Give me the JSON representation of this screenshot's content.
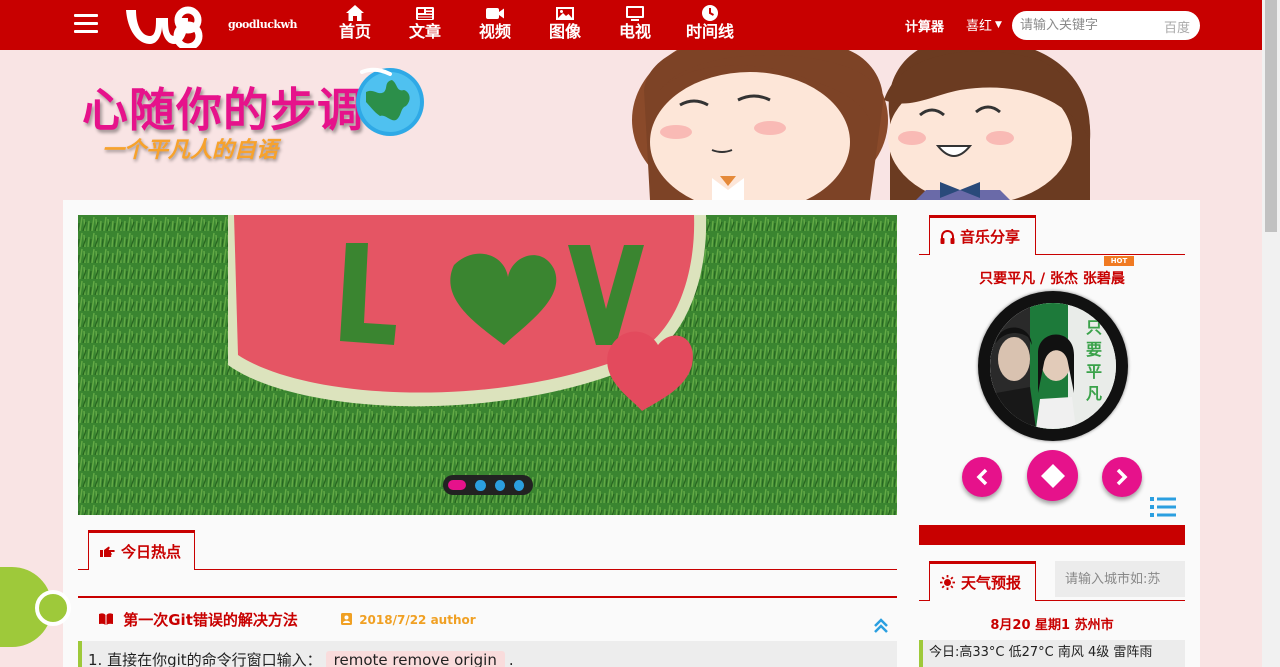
{
  "header": {
    "menu_icon": "hamburger-icon",
    "logo_icon": "w8-logo-icon",
    "site_name": "goodluckwh",
    "nav": [
      {
        "label": "首页",
        "icon": "home-icon"
      },
      {
        "label": "文章",
        "icon": "newspaper-icon"
      },
      {
        "label": "视频",
        "icon": "video-camera-icon"
      },
      {
        "label": "图像",
        "icon": "image-icon"
      },
      {
        "label": "电视",
        "icon": "tv-icon"
      },
      {
        "label": "时间线",
        "icon": "clock-icon"
      }
    ],
    "calculator": "计算器",
    "user": "喜红",
    "search": {
      "placeholder": "请输入关键字",
      "engine": "百度"
    }
  },
  "banner": {
    "title": "心随你的步调",
    "subtitle": "一个平凡人的自语"
  },
  "slider": {
    "image_icon": "watermelon-love-photo",
    "slide_count": 4,
    "active_slide": 1
  },
  "hot": {
    "tab_label": "今日热点",
    "tab_icon": "hand-pointing-icon"
  },
  "article": {
    "title": "第一次Git错误的解决方法",
    "title_icon": "books-icon",
    "meta": "2018/7/22 author",
    "meta_icon": "user-badge-icon",
    "body_prefix": "1. 直接在你git的命令行窗口输入：",
    "body_code": "remote remove origin",
    "body_suffix": "."
  },
  "music": {
    "tab_label": "音乐分享",
    "tab_icon": "headphones-icon",
    "badge": "HOT",
    "song": "只要平凡 / 张杰 张碧晨"
  },
  "weather": {
    "tab_label": "天气预报",
    "tab_icon": "sun-icon",
    "city_placeholder": "请输入城市如:苏",
    "date": "8月20 星期1 苏州市",
    "today": "今日:高33°C 低27°C 南风 4级 雷阵雨"
  },
  "colors": {
    "brand_red": "#c80000",
    "accent_pink": "#e6128b",
    "accent_blue": "#2b9fe0",
    "accent_green": "#9ec93a",
    "meta_orange": "#f0a023"
  }
}
